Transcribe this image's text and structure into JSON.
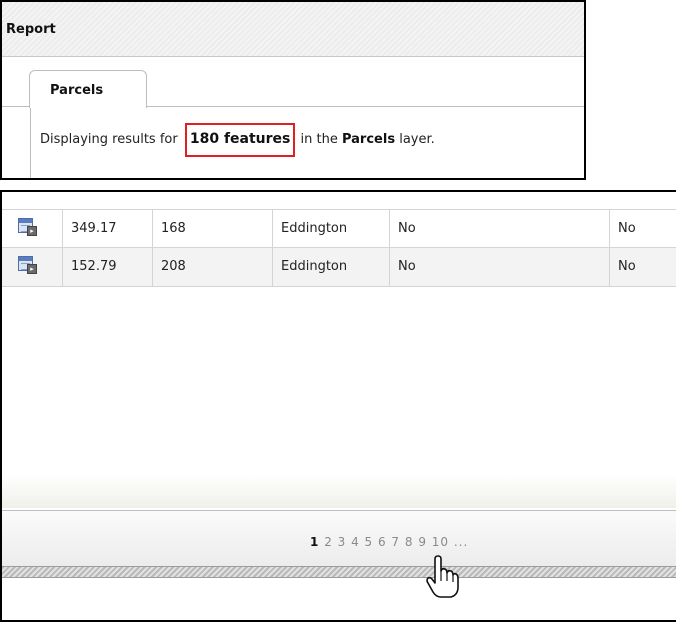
{
  "report": {
    "title": "Report",
    "tab_label": "Parcels",
    "result_prefix": "Displaying results for ",
    "feature_count": "180 features",
    "result_middle": " in the ",
    "layer_name": "Parcels",
    "result_suffix": " layer."
  },
  "grid": {
    "row_icon": "table-details-icon",
    "rows": [
      {
        "area": "349.17",
        "number": "168",
        "town": "Eddington",
        "field1": "No",
        "field2": "No"
      },
      {
        "area": "152.79",
        "number": "208",
        "town": "Eddington",
        "field1": "No",
        "field2": "No"
      }
    ]
  },
  "pager": {
    "current": "1",
    "pages": "2 3 4 5 6 7 8 9 10 ..."
  },
  "colors": {
    "highlight_border": "#e02020",
    "alt_row": "#f3f3f3"
  },
  "cursor": "hand-pointer-icon"
}
